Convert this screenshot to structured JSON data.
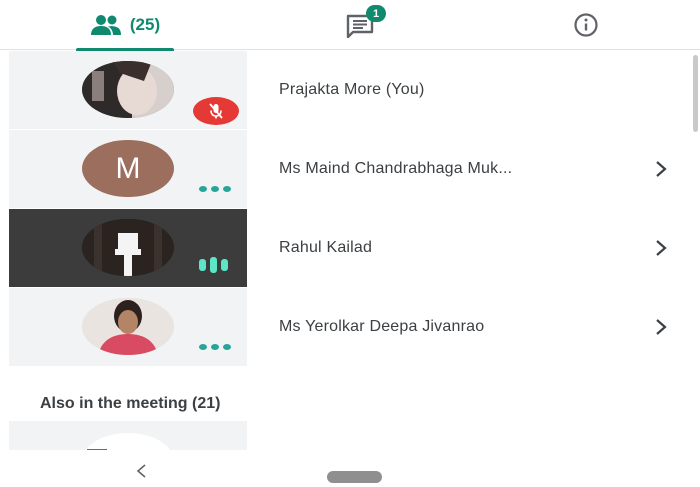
{
  "tabs": {
    "people": {
      "count": "(25)"
    },
    "chat": {
      "badge": "1"
    }
  },
  "participants": [
    {
      "name": "Prajakta More (You)",
      "avatar": "photo",
      "status": "muted"
    },
    {
      "name": "Ms Maind Chandrabhaga Muk...",
      "avatar": "letter",
      "letter": "M",
      "status": "dots"
    },
    {
      "name": "Rahul Kailad",
      "avatar": "photo",
      "status": "speaking"
    },
    {
      "name": "Ms Yerolkar Deepa Jivanrao",
      "avatar": "photo",
      "status": "dots"
    }
  ],
  "section": {
    "also_label": "Also in the meeting (21)"
  },
  "colors": {
    "accent": "#0f8a6f",
    "mute": "#e53935",
    "tile": "#f1f3f4"
  }
}
